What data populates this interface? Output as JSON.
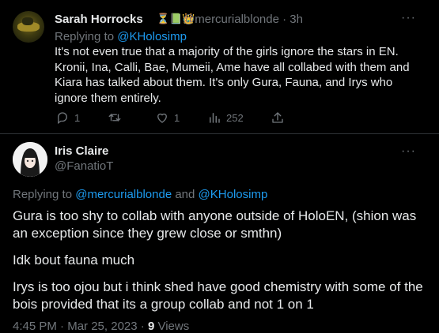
{
  "tweet1": {
    "display_name": "Sarah Horrocks",
    "badges": "⏳📗👑",
    "handle": "@mercurialblonde",
    "separator": "·",
    "time": "3h",
    "more": "···",
    "replying_prefix": "Replying to",
    "replying_to": "@KHolosimp",
    "body": "It's not even true that a majority of the girls ignore the stars in EN. Kronii, Ina, Calli, Bae, Mumeii, Ame have all collabed with them and Kiara has talked about them. It's only Gura, Fauna, and Irys who ignore them entirely.",
    "actions": {
      "replies": "1",
      "retweets": "",
      "likes": "1",
      "views": "252"
    }
  },
  "tweet2": {
    "display_name": "Iris Claire",
    "handle": "@FanatioT",
    "more": "···",
    "replying_prefix": "Replying to",
    "replying_to_1": "@mercurialblonde",
    "replying_and": "and",
    "replying_to_2": "@KHolosimp",
    "paragraphs": [
      "Gura is too shy to collab with anyone outside of HoloEN, (shion was an exception since they grew close or smthn)",
      "Idk bout fauna much",
      "Irys is too ojou but i think shed have good chemistry with some of the bois provided that its a group collab and not 1 on 1"
    ],
    "time": "4:45 PM",
    "sep1": "·",
    "date": "Mar 25, 2023",
    "sep2": "·",
    "views_count": "9",
    "views_label": "Views"
  },
  "colors": {
    "background": "#000000",
    "text": "#e7e9ea",
    "muted": "#71767b",
    "link": "#1d9bf0",
    "divider": "#2f3336"
  },
  "icons": [
    "more-icon",
    "reply-icon",
    "retweet-icon",
    "like-icon",
    "views-icon",
    "share-icon"
  ]
}
